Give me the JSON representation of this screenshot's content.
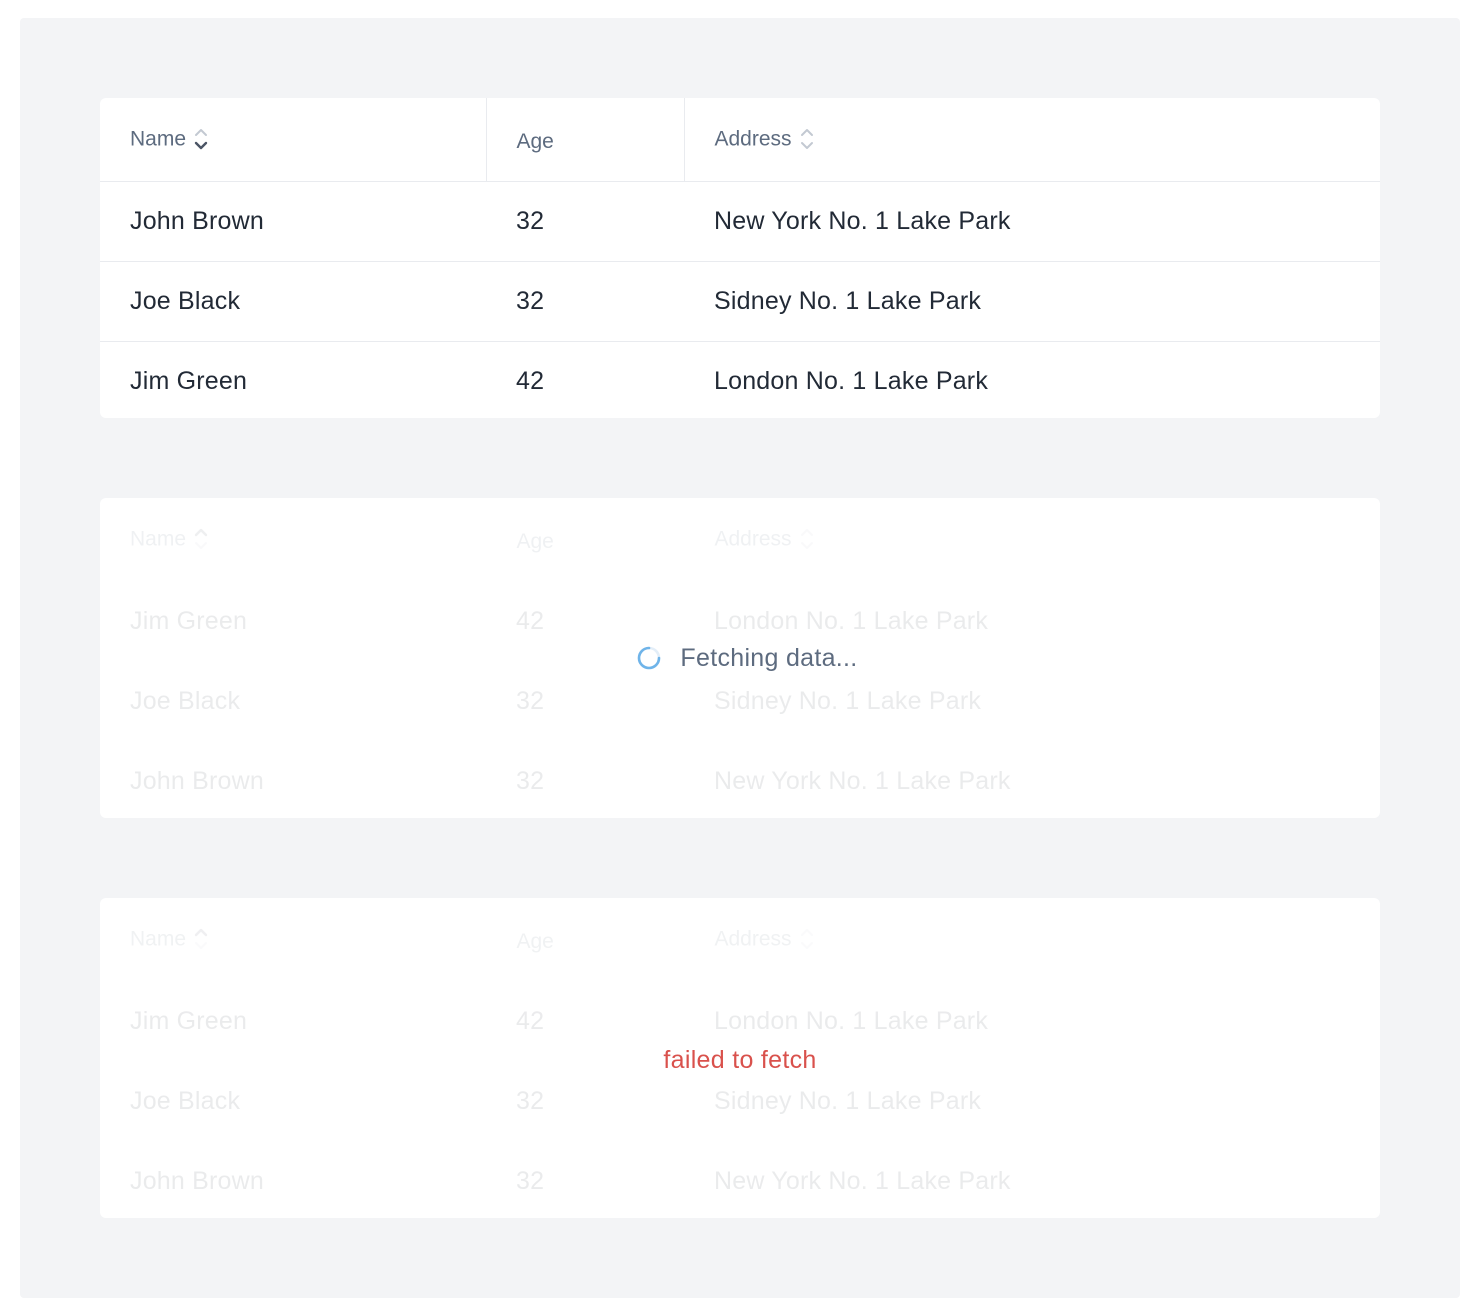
{
  "columns": {
    "name": "Name",
    "age": "Age",
    "address": "Address"
  },
  "tables": [
    {
      "state": "loaded",
      "rows": [
        {
          "name": "John Brown",
          "age": "32",
          "address": "New York No. 1 Lake Park"
        },
        {
          "name": "Joe Black",
          "age": "32",
          "address": "Sidney No. 1 Lake Park"
        },
        {
          "name": "Jim Green",
          "age": "42",
          "address": "London No. 1 Lake Park"
        }
      ]
    },
    {
      "state": "loading",
      "message": "Fetching data...",
      "rows": [
        {
          "name": "Jim Green",
          "age": "42",
          "address": "London No. 1 Lake Park"
        },
        {
          "name": "Joe Black",
          "age": "32",
          "address": "Sidney No. 1 Lake Park"
        },
        {
          "name": "John Brown",
          "age": "32",
          "address": "New York No. 1 Lake Park"
        }
      ]
    },
    {
      "state": "error",
      "message": "failed to fetch",
      "rows": [
        {
          "name": "Jim Green",
          "age": "42",
          "address": "London No. 1 Lake Park"
        },
        {
          "name": "Joe Black",
          "age": "32",
          "address": "Sidney No. 1 Lake Park"
        },
        {
          "name": "John Brown",
          "age": "32",
          "address": "New York No. 1 Lake Park"
        }
      ]
    }
  ],
  "icons": {
    "sort": "sort-icon",
    "spinner": "spinner-icon"
  },
  "colors": {
    "header_text": "#5d6b7f",
    "body_text": "#222a36",
    "error": "#d9514c",
    "spinner": "#5aa9e6",
    "background": "#f3f4f6"
  }
}
